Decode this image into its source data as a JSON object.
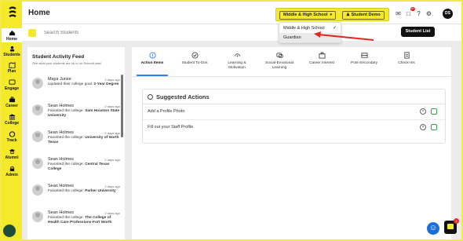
{
  "rail": {
    "items": [
      {
        "label": "Home",
        "icon": "home-icon"
      },
      {
        "label": "Students",
        "icon": "students-icon"
      },
      {
        "label": "Plan",
        "icon": "plan-icon"
      },
      {
        "label": "Engage",
        "icon": "engage-icon"
      },
      {
        "label": "Career",
        "icon": "career-icon"
      },
      {
        "label": "College",
        "icon": "college-icon"
      },
      {
        "label": "Track",
        "icon": "track-icon"
      },
      {
        "label": "Alumni",
        "icon": "alumni-icon"
      },
      {
        "label": "Admin",
        "icon": "admin-icon"
      }
    ],
    "accent": "#f5ea2a"
  },
  "header": {
    "title": "Home",
    "school_selector": "Middle & High School",
    "demo_button": "Student Demo",
    "notification_count": "9+",
    "avatar_initials": "DS"
  },
  "search": {
    "placeholder": "Search Students",
    "student_list_button": "Student List"
  },
  "dropdown": {
    "options": [
      {
        "label": "Middle & High School",
        "selected": true
      },
      {
        "label": "Guardian",
        "selected": false
      }
    ]
  },
  "feed": {
    "title": "Student Activity Feed",
    "subtitle": "See what your students are up to on SchoolLinks!",
    "items": [
      {
        "name": "Maya Junior",
        "time": "2 days ago",
        "action": "Updated their college goal:",
        "detail": "2-Year Degree"
      },
      {
        "name": "Sean Holmes",
        "time": "2 days ago",
        "action": "Favorited the college:",
        "detail": "Sam Houston State University"
      },
      {
        "name": "Sean Holmes",
        "time": "2 days ago",
        "action": "Favorited the college:",
        "detail": "University of North Texas"
      },
      {
        "name": "Sean Holmes",
        "time": "2 days ago",
        "action": "Favorited the college:",
        "detail": "Central Texas College"
      },
      {
        "name": "Sean Holmes",
        "time": "2 days ago",
        "action": "Favorited the college:",
        "detail": "Parker University"
      },
      {
        "name": "Sean Holmes",
        "time": "2 days ago",
        "action": "Favorited the college:",
        "detail": "The College of Health Care Professions-Fort Worth"
      }
    ]
  },
  "tabs": [
    {
      "label": "Action Items",
      "icon": "action-items-icon"
    },
    {
      "label": "Student To-Dos",
      "icon": "check-circle-icon"
    },
    {
      "label": "Learning & Motivation",
      "icon": "learning-icon"
    },
    {
      "label": "Social-Emotional Learning",
      "icon": "social-emotional-icon"
    },
    {
      "label": "Career Interest",
      "icon": "briefcase-icon"
    },
    {
      "label": "Post-Secondary",
      "icon": "post-secondary-icon"
    },
    {
      "label": "Check-Ins",
      "icon": "check-ins-icon"
    }
  ],
  "suggested": {
    "title": "Suggested Actions",
    "items": [
      "Add a Profile Photo",
      "Fill out your Staff Profile"
    ]
  },
  "help_button": "accessibility-icon",
  "chat_badge": "1"
}
